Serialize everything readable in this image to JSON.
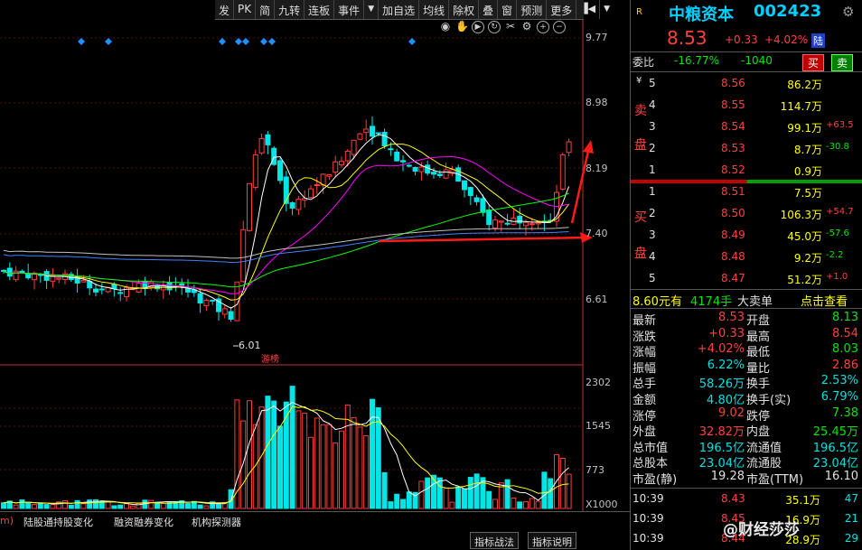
{
  "toolbar": {
    "items": [
      "发",
      "PK",
      "简",
      "九转",
      "连板",
      "事件",
      "加自选",
      "均线",
      "除权",
      "叠",
      "窗",
      "预测",
      "更多"
    ]
  },
  "icons": [
    "eye-icon",
    "hand-icon",
    "play-icon",
    "refresh-icon",
    "scissors-icon",
    "gear-icon",
    "zoom-in-icon",
    "zoom-out-icon"
  ],
  "price_axis": [
    "9.77",
    "8.98",
    "8.19",
    "7.40",
    "6.61"
  ],
  "volume_axis": [
    "2302",
    "1545",
    "773",
    "X1000"
  ],
  "annotations": {
    "low_label": "6.01",
    "tag": "游榜"
  },
  "colors": {
    "up": "#ff3c3c",
    "down": "#00e5e5",
    "bg": "#000000",
    "title": "#00d0ff"
  },
  "header": {
    "flag": "R",
    "name": "中粮资本",
    "code": "002423",
    "price": "8.53",
    "change": "+0.33",
    "pct": "+4.02%",
    "market": "陆"
  },
  "weibi": {
    "label": "委比",
    "ratio": "-16.77%",
    "diff": "-1040",
    "buy": "买",
    "sell": "卖"
  },
  "sell_side": {
    "label_top": "卖",
    "label_bottom": "盘",
    "sym": "¥",
    "rows": [
      {
        "lvl": "5",
        "price": "8.56",
        "vol": "86.2万",
        "chg": ""
      },
      {
        "lvl": "4",
        "price": "8.55",
        "vol": "114.7万",
        "chg": ""
      },
      {
        "lvl": "3",
        "price": "8.54",
        "vol": "99.1万",
        "chg": "+63.5"
      },
      {
        "lvl": "2",
        "price": "8.53",
        "vol": "8.7万",
        "chg": "-30.8"
      },
      {
        "lvl": "1",
        "price": "8.52",
        "vol": "0.9万",
        "chg": ""
      }
    ]
  },
  "buy_side": {
    "label_top": "买",
    "label_bottom": "盘",
    "rows": [
      {
        "lvl": "1",
        "price": "8.51",
        "vol": "7.5万",
        "chg": ""
      },
      {
        "lvl": "2",
        "price": "8.50",
        "vol": "106.3万",
        "chg": "+54.7"
      },
      {
        "lvl": "3",
        "price": "8.49",
        "vol": "45.0万",
        "chg": "-57.6"
      },
      {
        "lvl": "4",
        "price": "8.48",
        "vol": "9.2万",
        "chg": "-2.2"
      },
      {
        "lvl": "5",
        "price": "8.47",
        "vol": "51.2万",
        "chg": "+1.0"
      }
    ]
  },
  "bigorder": {
    "price": "8.60元有",
    "qty": "4174手",
    "label": "大卖单",
    "link": "点击查看"
  },
  "stats": [
    {
      "l1": "最新",
      "v1": "8.53",
      "c1": "red",
      "l2": "开盘",
      "v2": "8.13",
      "c2": "grn"
    },
    {
      "l1": "涨跌",
      "v1": "+0.33",
      "c1": "red",
      "l2": "最高",
      "v2": "8.54",
      "c2": "red"
    },
    {
      "l1": "涨幅",
      "v1": "+4.02%",
      "c1": "red",
      "l2": "最低",
      "v2": "8.03",
      "c2": "grn"
    },
    {
      "l1": "振幅",
      "v1": "6.22%",
      "c1": "cyn",
      "l2": "量比",
      "v2": "2.86",
      "c2": "red"
    },
    {
      "l1": "总手",
      "v1": "58.26万",
      "c1": "cyn",
      "l2": "换手",
      "v2": "2.53%",
      "c2": "cyn"
    },
    {
      "l1": "金额",
      "v1": "4.80亿",
      "c1": "cyn",
      "l2": "换手(实)",
      "v2": "6.79%",
      "c2": "cyn"
    },
    {
      "l1": "涨停",
      "v1": "9.02",
      "c1": "red",
      "l2": "跌停",
      "v2": "7.38",
      "c2": "grn"
    },
    {
      "l1": "外盘",
      "v1": "32.82万",
      "c1": "red",
      "l2": "内盘",
      "v2": "25.45万",
      "c2": "grn"
    },
    {
      "l1": "总市值",
      "v1": "196.5亿",
      "c1": "cyn",
      "l2": "流通值",
      "v2": "196.5亿",
      "c2": "cyn"
    },
    {
      "l1": "总股本",
      "v1": "23.04亿",
      "c1": "cyn",
      "l2": "流通股",
      "v2": "23.04亿",
      "c2": "cyn"
    },
    {
      "l1": "市盈(静)",
      "v1": "19.28",
      "c1": "wht",
      "l2": "市盈(TTM)",
      "v2": "16.10",
      "c2": "wht"
    }
  ],
  "ticks": [
    {
      "time": "10:39",
      "price": "8.43",
      "vol": "35.1万",
      "n": "47"
    },
    {
      "time": "10:39",
      "price": "8.45",
      "vol": "16.9万",
      "n": "21"
    },
    {
      "time": "10:39",
      "price": "8.44",
      "vol": "28.9万",
      "n": "29"
    }
  ],
  "bottom_tabs": [
    "陆股通持股变化",
    "融资融券变化",
    "机构探测器"
  ],
  "bottom_buttons": [
    "指标战法",
    "指标说明"
  ],
  "watermark": "@财经莎莎"
}
